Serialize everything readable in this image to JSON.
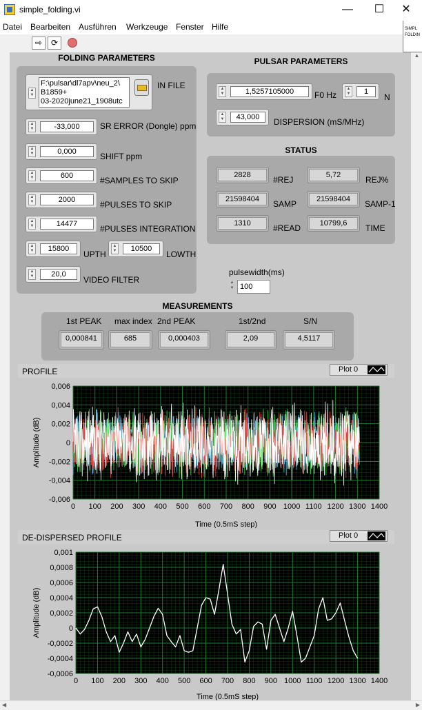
{
  "window": {
    "title": "simple_folding.vi",
    "minimize": "—",
    "maximize": "☐",
    "close": "✕"
  },
  "menu": [
    "Datei",
    "Bearbeiten",
    "Ausführen",
    "Werkzeuge",
    "Fenster",
    "Hilfe"
  ],
  "sidepane": {
    "line1": "SIMPL",
    "line2": "FOLDIN"
  },
  "folding": {
    "title": "FOLDING PARAMETERS",
    "infile_label": "IN FILE",
    "infile_path": [
      "F:\\pulsar\\dl7apv\\neu_2\\",
      "B1859+",
      "03-2020june21_1908utc"
    ],
    "sr_error": {
      "label": "SR ERROR (Dongle) ppm",
      "value": "-33,000"
    },
    "shift": {
      "label": "SHIFT ppm",
      "value": "0,000"
    },
    "samples_skip": {
      "label": "#SAMPLES TO SKIP",
      "value": "600"
    },
    "pulses_skip": {
      "label": "#PULSES TO SKIP",
      "value": "2000"
    },
    "pulses_int": {
      "label": "#PULSES INTEGRATION",
      "value": "14477"
    },
    "upth": {
      "label": "UPTH",
      "value": "15800"
    },
    "lowth": {
      "label": "LOWTH",
      "value": "10500"
    },
    "video_filter": {
      "label": "VIDEO FILTER",
      "value": "20,0"
    }
  },
  "pulsar": {
    "title": "PULSAR PARAMETERS",
    "f0": {
      "label": "F0 Hz",
      "value": "1,5257105000"
    },
    "n": {
      "label": "N",
      "value": "1"
    },
    "dispersion": {
      "label": "DISPERSION (mS/MHz)",
      "value": "43,000"
    }
  },
  "status": {
    "title": "STATUS",
    "rej": {
      "label": "#REJ",
      "value": "2828"
    },
    "rej_pct": {
      "label": "REJ%",
      "value": "5,72"
    },
    "samp": {
      "label": "SAMP",
      "value": "21598404"
    },
    "samp1": {
      "label": "SAMP-1",
      "value": "21598404"
    },
    "read": {
      "label": "#READ",
      "value": "1310"
    },
    "time": {
      "label": "TIME",
      "value": "10799,6"
    }
  },
  "pulsewidth": {
    "label": "pulsewidth(ms)",
    "value": "100"
  },
  "measurements": {
    "title": "MEASUREMENTS",
    "first_peak": {
      "label": "1st PEAK",
      "value": "0,000841"
    },
    "max_index": {
      "label": "max index",
      "value": "685"
    },
    "second_peak": {
      "label": "2nd PEAK",
      "value": "0,000403"
    },
    "ratio": {
      "label": "1st/2nd",
      "value": "2,09"
    },
    "sn": {
      "label": "S/N",
      "value": "4,5117"
    }
  },
  "colors": {
    "plot_bg": "#000000",
    "grid": "#1f7a2e",
    "trace": "#ffffff",
    "trace_red": "#e04848",
    "trace_green": "#3cd04a",
    "trace_cyan": "#50b4e8"
  },
  "chart_data": [
    {
      "type": "line",
      "title": "PROFILE",
      "legend": "Plot 0",
      "xlabel": "Time (0.5mS step)",
      "ylabel": "Amplitude (dB)",
      "xlim": [
        0,
        1400
      ],
      "ylim": [
        -0.006,
        0.006
      ],
      "x_ticks": [
        "0",
        "100",
        "200",
        "300",
        "400",
        "500",
        "600",
        "700",
        "800",
        "900",
        "1000",
        "1100",
        "1200",
        "1300",
        "1400"
      ],
      "y_ticks": [
        "0,006",
        "0,004",
        "0,002",
        "0",
        "-0,002",
        "-0,004",
        "-0,006"
      ],
      "grid": true,
      "series": [
        {
          "color": "#ffffff",
          "noise_amplitude": 0.0047
        },
        {
          "color": "#e04848",
          "noise_amplitude": 0.004
        },
        {
          "color": "#3cd04a",
          "noise_amplitude": 0.004
        },
        {
          "color": "#50b4e8",
          "noise_amplitude": 0.0036
        }
      ],
      "x_range_data": [
        0,
        1310
      ]
    },
    {
      "type": "line",
      "title": "DE-DISPERSED PROFILE",
      "legend": "Plot 0",
      "xlabel": "Time (0.5mS step)",
      "ylabel": "Amplitude (dB)",
      "xlim": [
        0,
        1400
      ],
      "ylim": [
        -0.0006,
        0.001
      ],
      "x_ticks": [
        "0",
        "100",
        "200",
        "300",
        "400",
        "500",
        "600",
        "700",
        "800",
        "900",
        "1000",
        "1100",
        "1200",
        "1300",
        "1400"
      ],
      "y_ticks": [
        "0,001",
        "0,0008",
        "0,0006",
        "0,0004",
        "0,0002",
        "0",
        "-0,0002",
        "-0,0004",
        "-0,0006"
      ],
      "grid": true,
      "x": [
        0,
        20,
        40,
        60,
        80,
        100,
        120,
        140,
        160,
        180,
        200,
        220,
        240,
        260,
        280,
        300,
        320,
        340,
        360,
        380,
        400,
        420,
        440,
        460,
        480,
        500,
        520,
        540,
        560,
        580,
        600,
        620,
        640,
        660,
        680,
        700,
        720,
        740,
        760,
        780,
        800,
        820,
        840,
        860,
        880,
        900,
        920,
        940,
        960,
        980,
        1000,
        1020,
        1040,
        1060,
        1080,
        1100,
        1120,
        1140,
        1160,
        1180,
        1200,
        1220,
        1240,
        1260,
        1280,
        1300
      ],
      "y": [
        0.0,
        -8e-05,
        -2e-05,
        0.0001,
        0.00025,
        0.00028,
        0.00015,
        -5e-05,
        -0.00018,
        -0.0001,
        -0.00032,
        -0.0002,
        -5e-05,
        -0.00018,
        -8e-05,
        -0.00025,
        -0.00015,
        0.0,
        0.00015,
        0.00026,
        0.00018,
        -0.0001,
        -0.00018,
        -0.00025,
        -0.0001,
        -0.0003,
        -0.00032,
        -0.0003,
        0.0,
        0.0003,
        0.0004,
        0.00038,
        0.00018,
        0.0005,
        0.00084,
        0.00045,
        5e-05,
        -8e-05,
        -2e-05,
        -0.00045,
        -0.0003,
        2e-05,
        8e-05,
        5e-05,
        -0.00028,
        0.0001,
        0.00018,
        0.0,
        -0.00018,
        0.0,
        0.00022,
        -0.0001,
        -0.00045,
        -0.0004,
        -0.00025,
        -0.0001,
        0.00025,
        0.0004,
        0.0001,
        0.00012,
        0.0002,
        0.00033,
        0.0001,
        -0.00012,
        -0.0003,
        -0.0004
      ]
    }
  ]
}
